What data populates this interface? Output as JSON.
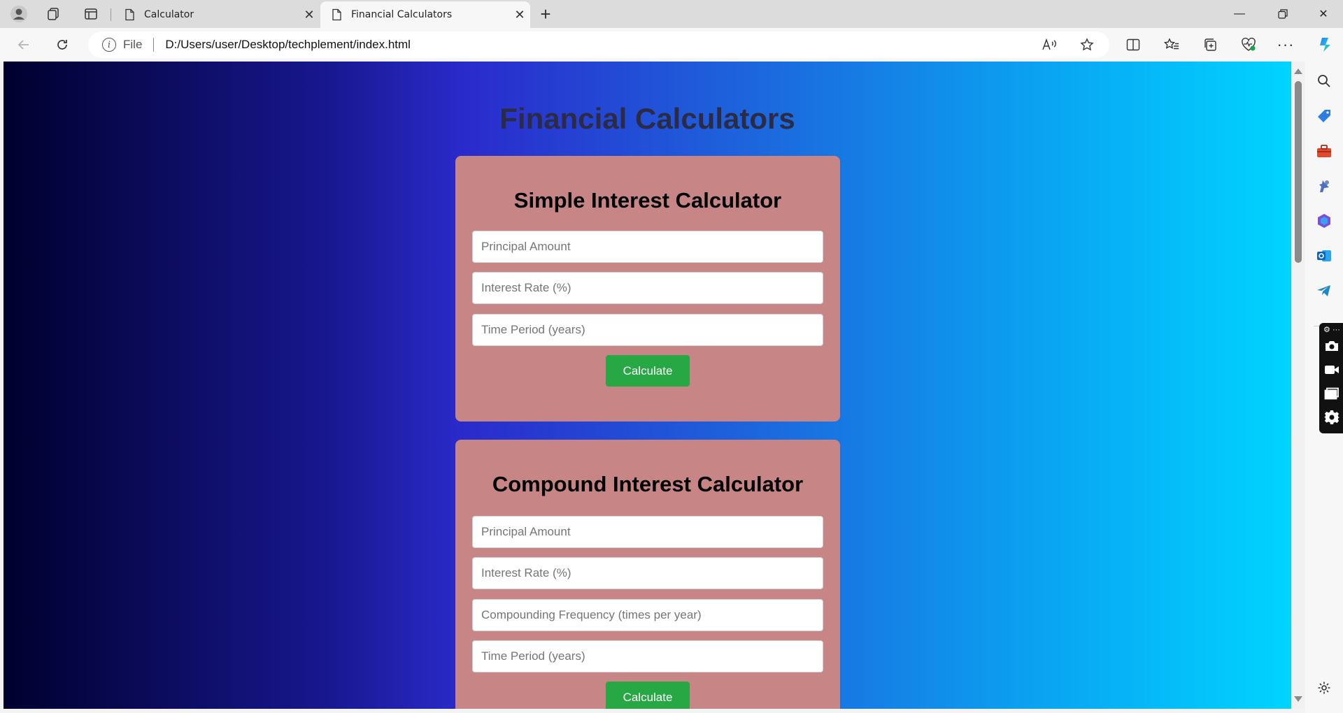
{
  "browser": {
    "tabs": [
      {
        "title": "Calculator",
        "active": false
      },
      {
        "title": "Financial Calculators",
        "active": true
      }
    ],
    "address": {
      "scheme_label": "File",
      "url": "D:/Users/user/Desktop/techplement/index.html"
    },
    "accent_color": "#1a73e8"
  },
  "page": {
    "title": "Financial Calculators",
    "simple": {
      "title": "Simple Interest Calculator",
      "principal_placeholder": "Principal Amount",
      "rate_placeholder": "Interest Rate (%)",
      "time_placeholder": "Time Period (years)",
      "button": "Calculate"
    },
    "compound": {
      "title": "Compound Interest Calculator",
      "principal_placeholder": "Principal Amount",
      "rate_placeholder": "Interest Rate (%)",
      "frequency_placeholder": "Compounding Frequency (times per year)",
      "time_placeholder": "Time Period (years)",
      "button": "Calculate"
    },
    "colors": {
      "card": "#c88585",
      "button": "#28a745",
      "title": "#2b2b45"
    }
  },
  "sidebar": {
    "icons": [
      "search-icon",
      "shopping-tag-icon",
      "toolbox-icon",
      "games-icon",
      "office-icon",
      "outlook-icon",
      "telegram-icon",
      "settings-icon"
    ],
    "capture_tools": [
      "camera-icon",
      "video-icon",
      "window-icon",
      "gear-icon"
    ]
  }
}
